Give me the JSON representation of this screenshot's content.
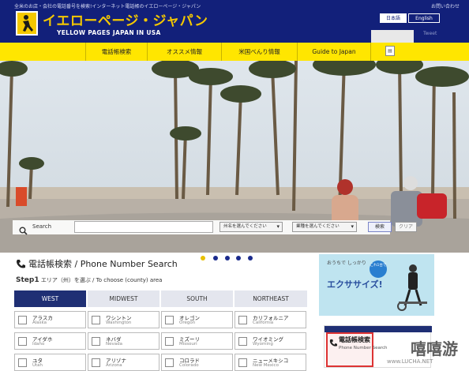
{
  "header": {
    "tagline": "全米のお店・会社の電話番号を検索!インターネット電話帳のイエローページ・ジャパン",
    "top_link": "お問い合わせ",
    "logo_jp": "イエローページ・ジャパン",
    "logo_en": "YELLOW PAGES JAPAN IN USA",
    "lang_jp": "日本語",
    "lang_en": "English",
    "tweet": "Tweet"
  },
  "nav": {
    "items": [
      "電話帳検索",
      "オススメ情報",
      "米国べんり情報",
      "Guide to Japan"
    ]
  },
  "search": {
    "label": "Search",
    "placeholder": "",
    "state_select": "州名を選んでください",
    "category_select": "業種を選んでください",
    "search_button": "検索",
    "clear_button": "クリア"
  },
  "section": {
    "title": "電話帳検索 / Phone Number Search",
    "step_num": "Step1",
    "step_text": "エリア（州）を選ぶ / To choose (county) area"
  },
  "tabs": [
    "WEST",
    "MIDWEST",
    "SOUTH",
    "NORTHEAST"
  ],
  "states": [
    {
      "jp": "アラスカ",
      "en": "Alaska"
    },
    {
      "jp": "ワシントン",
      "en": "Washington"
    },
    {
      "jp": "オレゴン",
      "en": "Oregon"
    },
    {
      "jp": "カリフォルニア",
      "en": "California"
    },
    {
      "jp": "アイダホ",
      "en": "Idaho"
    },
    {
      "jp": "ネバダ",
      "en": "Nevada"
    },
    {
      "jp": "ミズーリ",
      "en": "Missouri"
    },
    {
      "jp": "ワイオミング",
      "en": "Wyoming"
    },
    {
      "jp": "ユタ",
      "en": "Utah"
    },
    {
      "jp": "アリゾナ",
      "en": "Arizona"
    },
    {
      "jp": "コロラド",
      "en": "Colorado"
    },
    {
      "jp": "ニューメキシコ",
      "en": "New Mexico"
    }
  ],
  "ads": {
    "ad1_small": "おうちで しっかり",
    "ad1_big": "エクササイズ!",
    "ad1_badge": "これ1台で",
    "ad2_text": "電話帳検索",
    "ad2_sub": "Phone Number Search"
  },
  "watermark": {
    "text": "嘻嘻游",
    "url": "www.LUCHA.NET"
  },
  "colors": {
    "header_bg": "#12207a",
    "brand_yellow": "#ffe600",
    "tab_active": "#1f2f74",
    "dot": "#1a2a8c",
    "dot_active": "#e8c000"
  }
}
